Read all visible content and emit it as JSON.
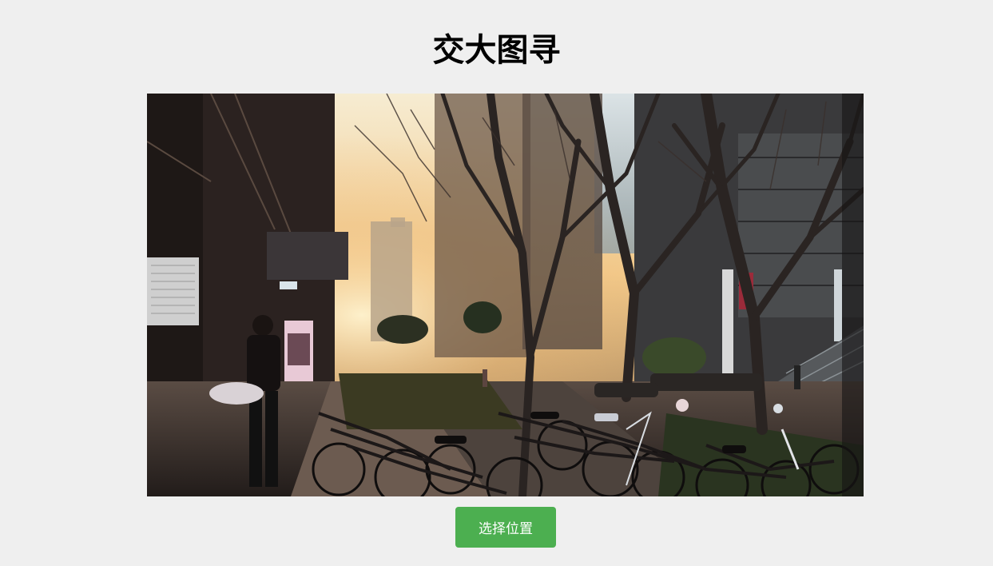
{
  "page": {
    "title": "交大图寻"
  },
  "photo": {
    "icon": "street-scene-image"
  },
  "actions": {
    "select_location_label": "选择位置"
  },
  "colors": {
    "background": "#efefef",
    "title": "#000000",
    "button": "#4caf50",
    "button_text": "#ffffff"
  }
}
